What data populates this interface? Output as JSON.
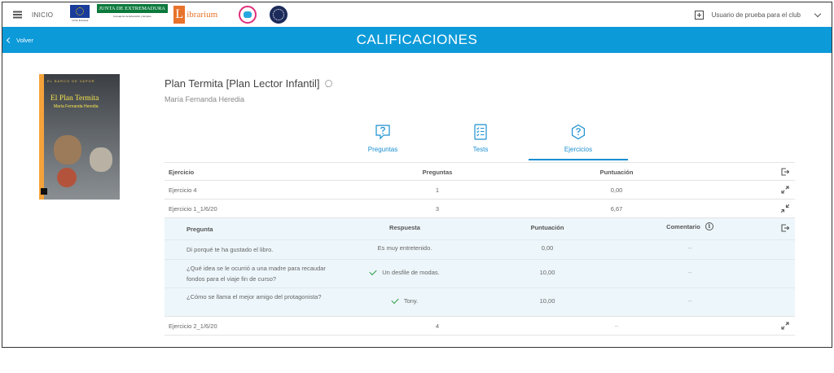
{
  "header": {
    "inicio_label": "INICIO",
    "logos": {
      "eu_caption": "Unión Europea",
      "junta_name": "JUNTA DE EXTREMADURA",
      "junta_caption": "Consejería de Educación y Empleo",
      "librarium_letter": "L",
      "librarium_name": "ibrarium"
    },
    "user_name": "Usuario de prueba para el club"
  },
  "titlebar": {
    "back_label": "Volver",
    "title": "CALIFICACIONES"
  },
  "book": {
    "title": "Plan Termita [Plan Lector Infantil]",
    "author": "María Fernanda Heredia",
    "cover": {
      "series": "EL BARCO DE VAPOR",
      "title": "El Plan Termita",
      "author": "María Fernanda Heredia"
    }
  },
  "tabs": [
    {
      "label": "Preguntas",
      "icon": "question-speech-icon",
      "active": false
    },
    {
      "label": "Tests",
      "icon": "checklist-icon",
      "active": false
    },
    {
      "label": "Ejercicios",
      "icon": "question-circle-icon",
      "active": true
    }
  ],
  "table": {
    "headers": {
      "ejercicio": "Ejercicio",
      "preguntas": "Preguntas",
      "puntuacion": "Puntuación"
    },
    "rows": [
      {
        "ejercicio": "Ejercicio 4",
        "preguntas": "1",
        "puntuacion": "0,00",
        "expanded": false
      },
      {
        "ejercicio": "Ejercicio 1_1/6/20",
        "preguntas": "3",
        "puntuacion": "6,67",
        "expanded": true
      },
      {
        "ejercicio": "Ejercicio 2_1/6/20",
        "preguntas": "4",
        "puntuacion": "--",
        "expanded": false
      }
    ]
  },
  "detail": {
    "headers": {
      "pregunta": "Pregunta",
      "respuesta": "Respuesta",
      "puntuacion": "Puntuación",
      "comentario": "Comentario"
    },
    "rows": [
      {
        "pregunta": "Di porqué te ha gustado el libro.",
        "respuesta": "Es muy entretenido.",
        "correct": false,
        "puntuacion": "0,00",
        "comentario": "--"
      },
      {
        "pregunta": "¿Qué idea se le ocurrió a una madre para recaudar fondos para el viaje fin de curso?",
        "respuesta": "Un desfile de modas.",
        "correct": true,
        "puntuacion": "10,00",
        "comentario": "--"
      },
      {
        "pregunta": "¿Cómo se llama el mejor amigo del protagonista?",
        "respuesta": "Tony.",
        "correct": true,
        "puntuacion": "10,00",
        "comentario": "--"
      }
    ]
  },
  "colors": {
    "accent": "#0d9ad9",
    "tab_text": "#1a8fd0",
    "check": "#2e9e48",
    "detail_bg": "#edf6fb"
  }
}
